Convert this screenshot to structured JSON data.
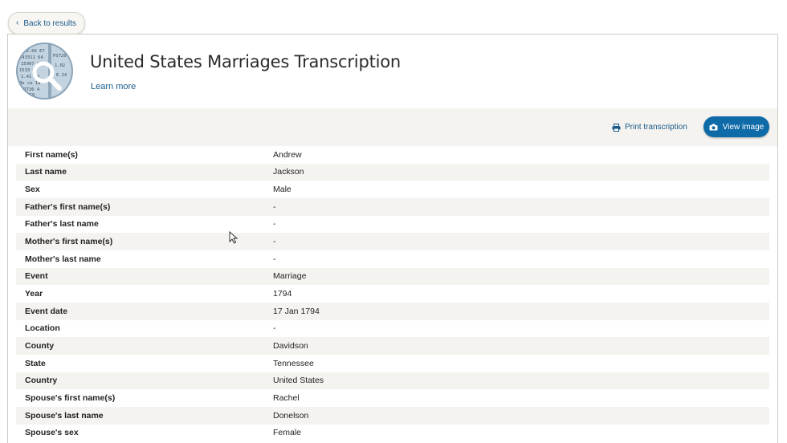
{
  "nav": {
    "back_label": "Back to results"
  },
  "header": {
    "title": "United States Marriages Transcription",
    "learn_more": "Learn more"
  },
  "toolbar": {
    "print_label": "Print transcription",
    "view_image_label": "View image"
  },
  "colors": {
    "accent": "#0f6aa8",
    "link": "#1a5a8a",
    "stripe": "#f4f3f0"
  },
  "fields": [
    {
      "label": "First name(s)",
      "value": "Andrew"
    },
    {
      "label": "Last name",
      "value": "Jackson"
    },
    {
      "label": "Sex",
      "value": "Male"
    },
    {
      "label": "Father's first name(s)",
      "value": "-"
    },
    {
      "label": "Father's last name",
      "value": "-"
    },
    {
      "label": "Mother's first name(s)",
      "value": "-"
    },
    {
      "label": "Mother's last name",
      "value": "-"
    },
    {
      "label": "Event",
      "value": "Marriage"
    },
    {
      "label": "Year",
      "value": "1794"
    },
    {
      "label": "Event date",
      "value": "17 Jan 1794"
    },
    {
      "label": "Location",
      "value": "-"
    },
    {
      "label": "County",
      "value": "Davidson"
    },
    {
      "label": "State",
      "value": "Tennessee"
    },
    {
      "label": "Country",
      "value": "United States"
    },
    {
      "label": "Spouse's first name(s)",
      "value": "Rachel"
    },
    {
      "label": "Spouse's last name",
      "value": "Donelson"
    },
    {
      "label": "Spouse's sex",
      "value": "Female"
    }
  ]
}
